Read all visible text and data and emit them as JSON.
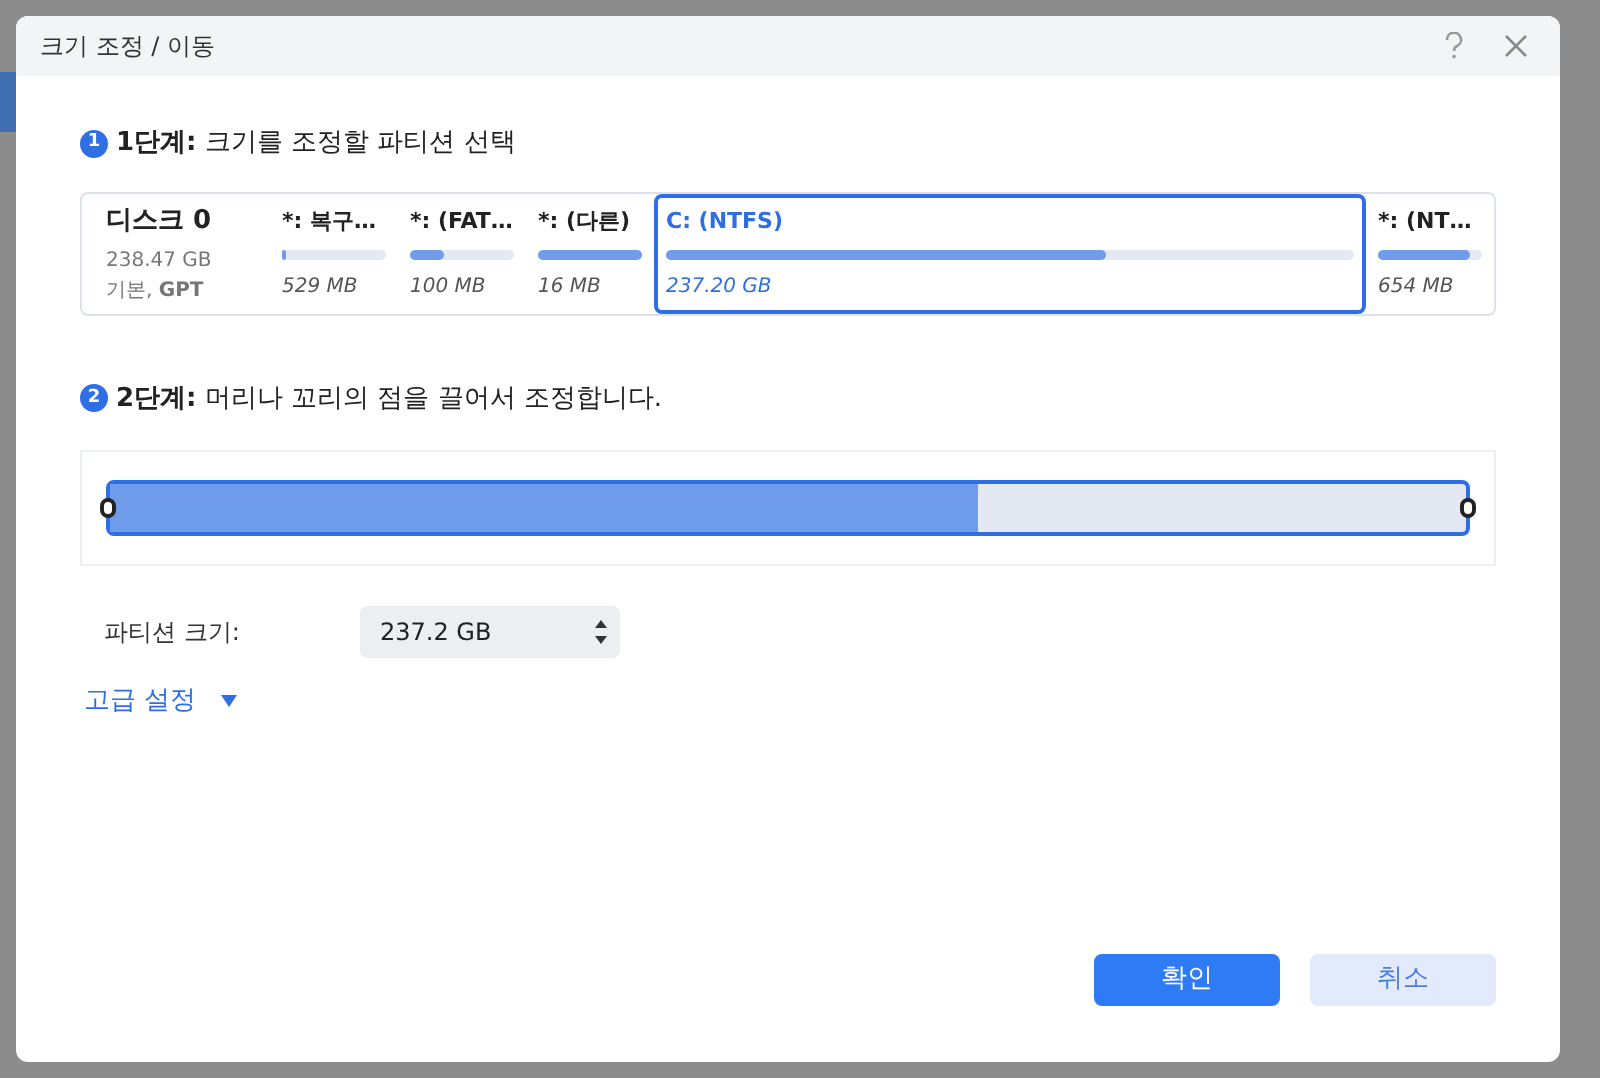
{
  "window": {
    "title": "크기 조정 / 이동"
  },
  "step1": {
    "number": "1",
    "label": "1단계:",
    "text": "크기를 조정할 파티션 선택"
  },
  "disk": {
    "name": "디스크",
    "index": "0",
    "size": "238.47 GB",
    "type_prefix": "기본,",
    "type": "GPT"
  },
  "partitions": [
    {
      "name": "*: 복구…",
      "level": 0.03,
      "size": "529 MB",
      "selected": false
    },
    {
      "name": "*: (FAT…",
      "level": 0.33,
      "size": "100 MB",
      "selected": false
    },
    {
      "name": "*: (다른)",
      "level": 1.0,
      "size": "16 MB",
      "selected": false
    },
    {
      "name": "C: (NTFS)",
      "level": 0.64,
      "size": "237.20 GB",
      "selected": true
    },
    {
      "name": "*: (NT…",
      "level": 0.88,
      "size": "654 MB",
      "selected": false
    }
  ],
  "step2": {
    "number": "2",
    "label": "2단계:",
    "text": "머리나 꼬리의 점을 끌어서 조정합니다."
  },
  "resize_bar": {
    "level": 0.64
  },
  "partition_size": {
    "label": "파티션 크기:",
    "value": "237.2 GB"
  },
  "advanced": {
    "label": "고급 설정",
    "expanded": false
  },
  "buttons": [
    {
      "label": "확인",
      "kind": "primary"
    },
    {
      "label": "취소",
      "kind": "secondary"
    }
  ]
}
